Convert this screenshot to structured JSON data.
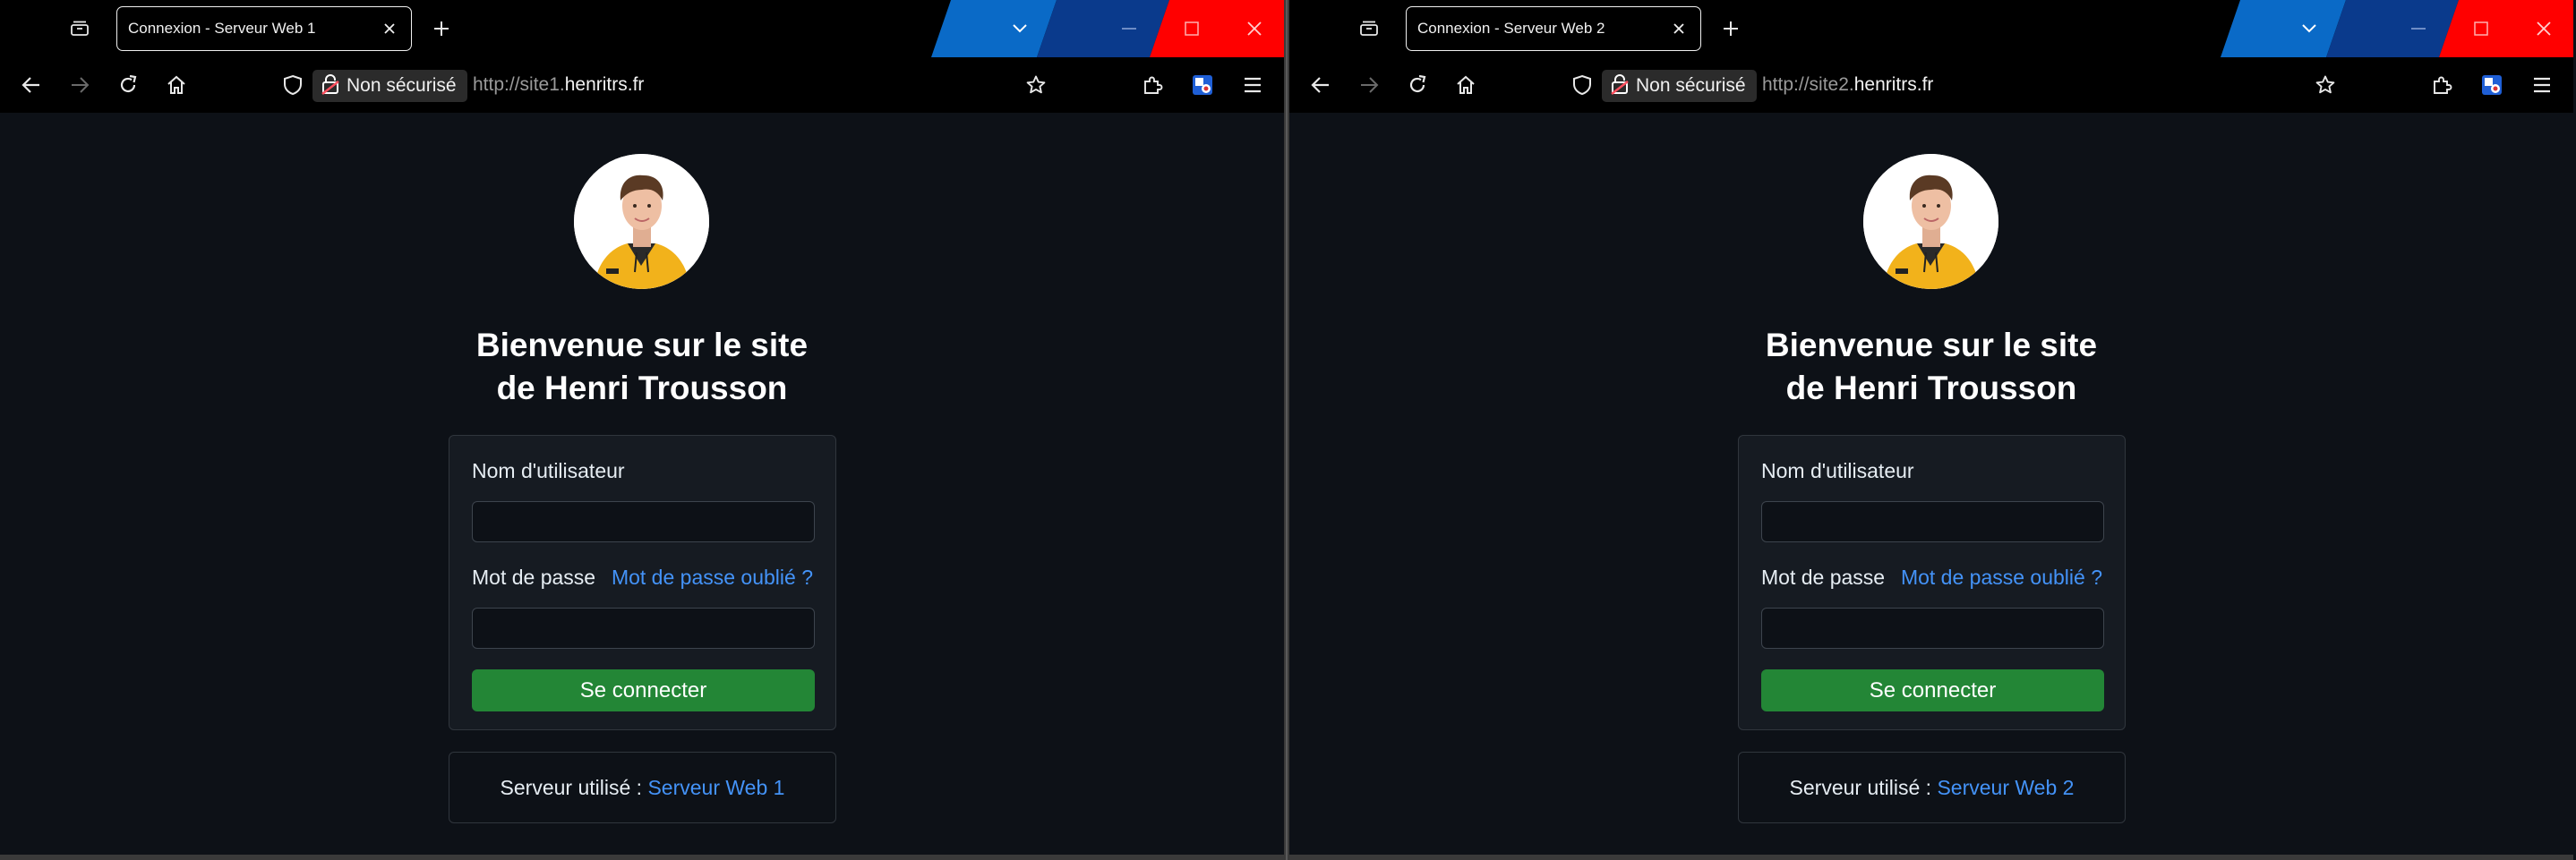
{
  "colors": {
    "page_bg": "#0d1117",
    "card_bg": "#161b22",
    "border": "#30363d",
    "link": "#4493f8",
    "button_green": "#238636",
    "chrome_bg": "#000000",
    "band_blue": "#0a6ac7",
    "band_dark_blue": "#0a3a8c",
    "band_red": "#ff0000"
  },
  "icons": {
    "tab_list": "tab-list-icon",
    "new_tab": "plus-icon",
    "back": "arrow-left-icon",
    "forward": "arrow-right-icon",
    "reload": "reload-icon",
    "home": "home-icon",
    "tracking": "shield-icon",
    "insecure": "broken-lock-icon",
    "bookmark": "star-icon",
    "extensions": "puzzle-icon",
    "profile": "profile-extension-icon",
    "menu": "hamburger-menu-icon"
  },
  "windows": [
    {
      "tab": {
        "title": "Connexion - Serveur Web 1"
      },
      "nav": {
        "security_label": "Non sécurisé",
        "url_prefix": "http://site1.",
        "url_domain": "henritrs.fr"
      },
      "page": {
        "heading_line1": "Bienvenue sur le site",
        "heading_line2": "de Henri Trousson",
        "username_label": "Nom d'utilisateur",
        "username_value": "",
        "password_label": "Mot de passe",
        "password_value": "",
        "forgot_link": "Mot de passe oublié ?",
        "submit_label": "Se connecter",
        "server_label": "Serveur utilisé : ",
        "server_name": "Serveur Web 1"
      }
    },
    {
      "tab": {
        "title": "Connexion - Serveur Web 2"
      },
      "nav": {
        "security_label": "Non sécurisé",
        "url_prefix": "http://site2.",
        "url_domain": "henritrs.fr"
      },
      "page": {
        "heading_line1": "Bienvenue sur le site",
        "heading_line2": "de Henri Trousson",
        "username_label": "Nom d'utilisateur",
        "username_value": "",
        "password_label": "Mot de passe",
        "password_value": "",
        "forgot_link": "Mot de passe oublié ?",
        "submit_label": "Se connecter",
        "server_label": "Serveur utilisé : ",
        "server_name": "Serveur Web 2"
      }
    }
  ]
}
